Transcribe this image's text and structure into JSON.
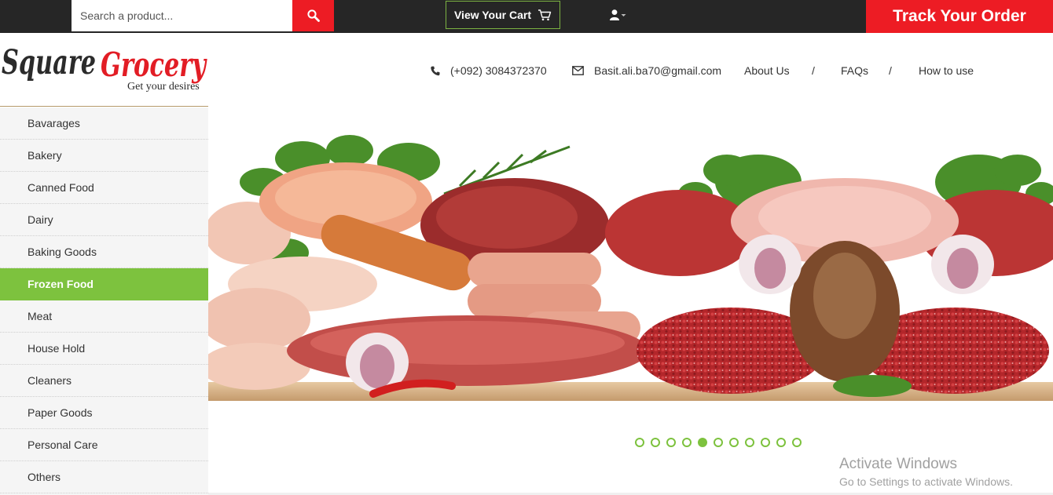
{
  "header": {
    "search": {
      "placeholder": "Search a product..."
    },
    "cart_label": "View Your Cart",
    "track_label": "Track Your Order"
  },
  "logo": {
    "title": "Square Grocery",
    "tagline": "Get your desires"
  },
  "contact": {
    "phone": "(+092) 3084372370",
    "email": "Basit.ali.ba70@gmail.com",
    "links": [
      "About Us",
      "FAQs",
      "How to use"
    ],
    "separator": "/"
  },
  "sidebar": {
    "items": [
      {
        "label": "Bavarages"
      },
      {
        "label": "Bakery"
      },
      {
        "label": "Canned Food"
      },
      {
        "label": "Dairy"
      },
      {
        "label": "Baking Goods"
      },
      {
        "label": "Frozen Food"
      },
      {
        "label": "Meat"
      },
      {
        "label": "House Hold"
      },
      {
        "label": "Cleaners"
      },
      {
        "label": "Paper Goods"
      },
      {
        "label": "Personal Care"
      },
      {
        "label": "Others"
      }
    ],
    "active_index": 5
  },
  "slider": {
    "count": 11,
    "active_index": 4
  },
  "watermark": {
    "title": "Activate Windows",
    "subtitle": "Go to Settings to activate Windows."
  },
  "colors": {
    "accent_red": "#ed1c24",
    "accent_green": "#7dc23e",
    "topbar": "#262626"
  },
  "icons": [
    "search-icon",
    "cart-icon",
    "user-icon",
    "phone-icon",
    "envelope-icon"
  ]
}
